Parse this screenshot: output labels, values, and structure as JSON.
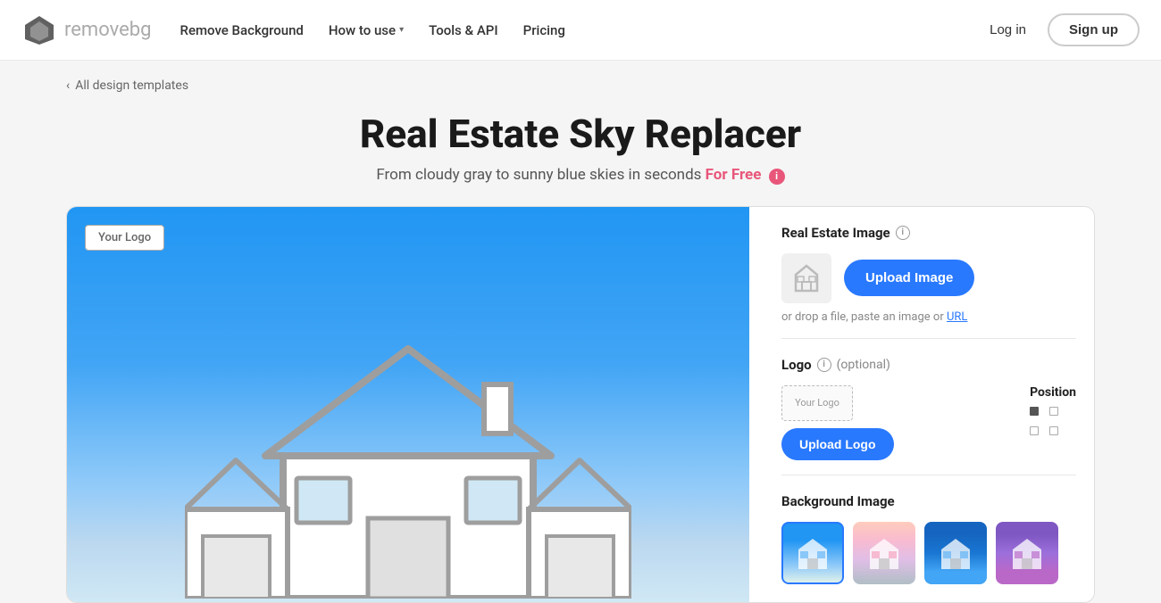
{
  "navbar": {
    "logo_text_main": "remove",
    "logo_text_accent": "bg",
    "nav_items": [
      {
        "label": "Remove Background",
        "id": "remove-bg",
        "has_arrow": false
      },
      {
        "label": "How to use",
        "id": "how-to-use",
        "has_arrow": true
      },
      {
        "label": "Tools & API",
        "id": "tools-api",
        "has_arrow": false
      },
      {
        "label": "Pricing",
        "id": "pricing",
        "has_arrow": false
      }
    ],
    "login_label": "Log in",
    "signup_label": "Sign up"
  },
  "breadcrumb": {
    "label": "All design templates",
    "arrow": "‹"
  },
  "page": {
    "title": "Real Estate Sky Replacer",
    "subtitle": "From cloudy gray to sunny blue skies in seconds",
    "for_free": "For Free"
  },
  "right_panel": {
    "real_estate_section_title": "Real Estate Image",
    "upload_image_btn": "Upload Image",
    "drop_hint": "or drop a file, paste an image or",
    "drop_hint_link": "URL",
    "logo_section_title": "Logo",
    "logo_optional": "(optional)",
    "upload_logo_btn": "Upload Logo",
    "position_label": "Position",
    "logo_placeholder": "Your Logo",
    "bg_section_title": "Background Image"
  },
  "your_logo_badge": "Your Logo",
  "colors": {
    "upload_btn": "#2979ff",
    "for_free": "#e8577a"
  }
}
